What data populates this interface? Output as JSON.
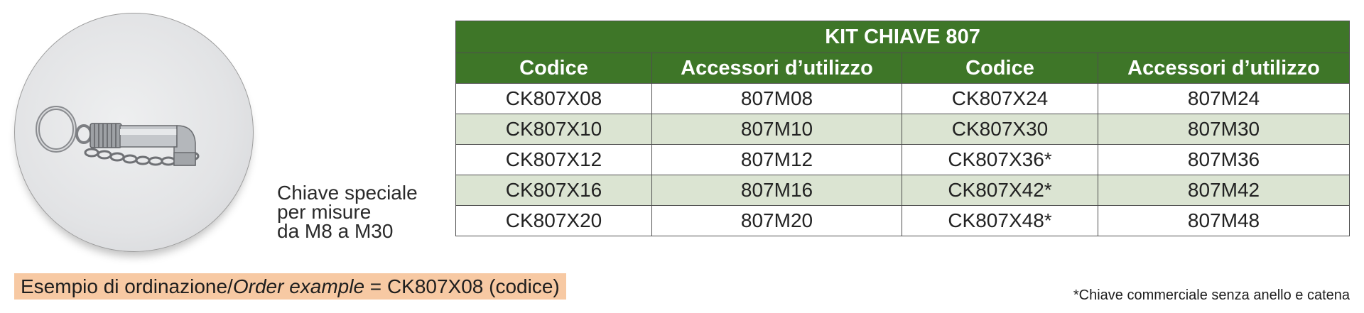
{
  "product": {
    "image_name": "hex-key-with-ring-and-chain",
    "caption": "Chiave speciale\nper misure\nda M8 a M30"
  },
  "table": {
    "title": "KIT CHIAVE 807",
    "headers": [
      "Codice",
      "Accessori d’utilizzo",
      "Codice",
      "Accessori d’utilizzo"
    ],
    "rows": [
      [
        "CK807X08",
        "807M08",
        "CK807X24",
        "807M24"
      ],
      [
        "CK807X10",
        "807M10",
        "CK807X30",
        "807M30"
      ],
      [
        "CK807X12",
        "807M12",
        "CK807X36*",
        "807M36"
      ],
      [
        "CK807X16",
        "807M16",
        "CK807X42*",
        "807M42"
      ],
      [
        "CK807X20",
        "807M20",
        "CK807X48*",
        "807M48"
      ]
    ]
  },
  "order_example": {
    "prefix": "Esempio di ordinazione/",
    "italic": "Order example",
    "suffix": " = CK807X08 (codice)"
  },
  "footnote": "*Chiave commerciale senza anello e catena",
  "colors": {
    "header_green": "#3e7628",
    "row_alt": "#dbe4d2",
    "order_highlight": "#f7c9a3"
  }
}
